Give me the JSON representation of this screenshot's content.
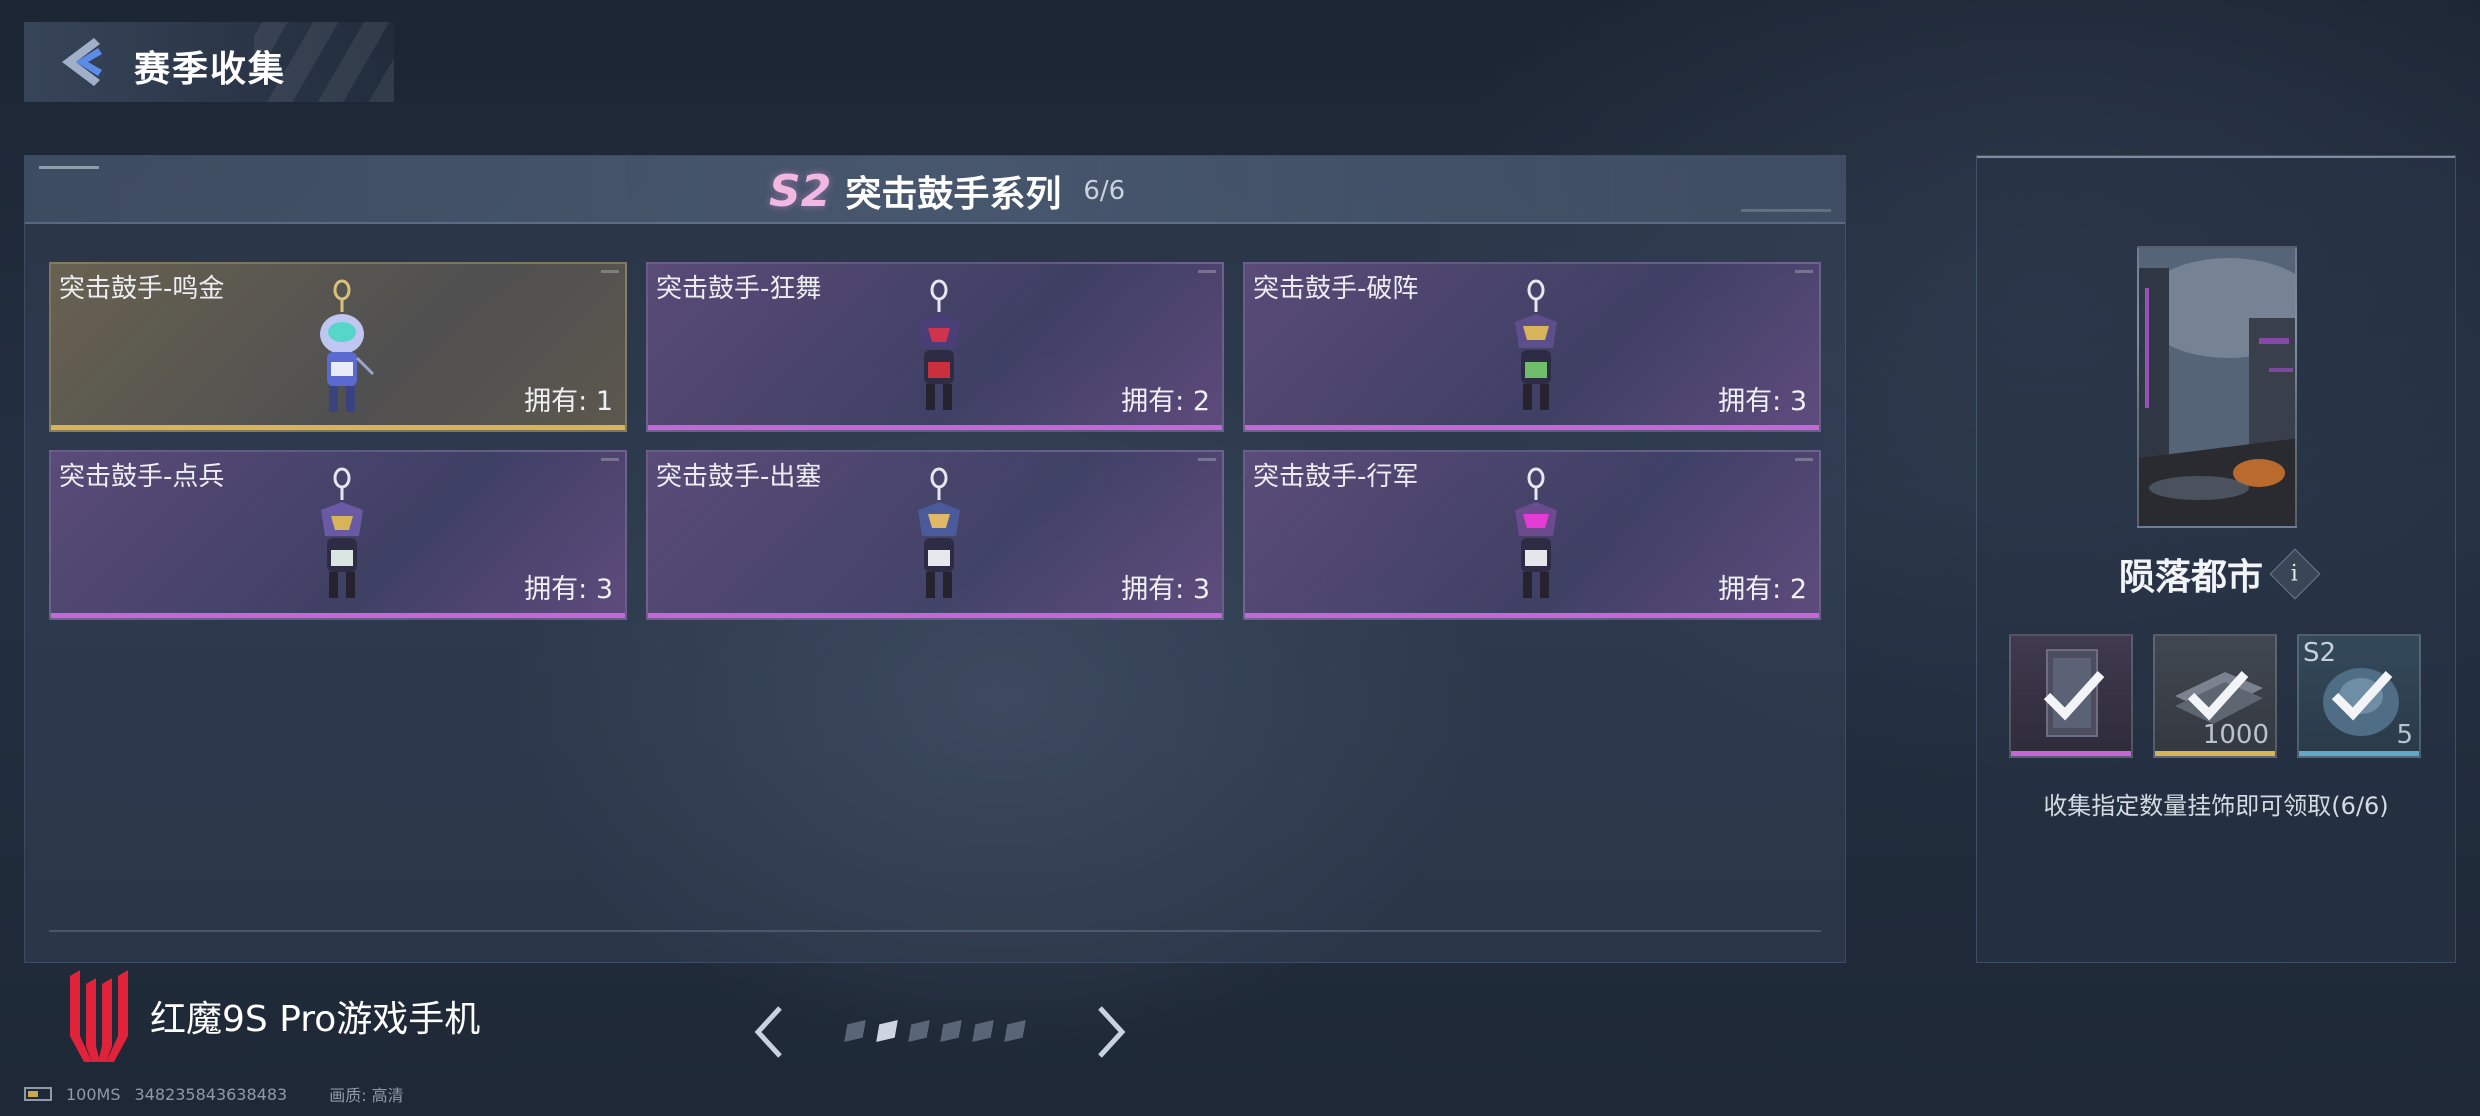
{
  "header": {
    "title": "赛季收集"
  },
  "series": {
    "badge": "S2",
    "title": "突击鼓手系列",
    "progress": "6/6"
  },
  "items": [
    {
      "name": "突击鼓手-鸣金",
      "owned": "拥有: 1",
      "rarity": "gold",
      "accent": "#d8b457"
    },
    {
      "name": "突击鼓手-狂舞",
      "owned": "拥有: 2",
      "rarity": "purple",
      "accent": "#c567d8"
    },
    {
      "name": "突击鼓手-破阵",
      "owned": "拥有: 3",
      "rarity": "purple",
      "accent": "#c567d8"
    },
    {
      "name": "突击鼓手-点兵",
      "owned": "拥有: 3",
      "rarity": "purple",
      "accent": "#c567d8"
    },
    {
      "name": "突击鼓手-出塞",
      "owned": "拥有: 3",
      "rarity": "purple",
      "accent": "#c567d8"
    },
    {
      "name": "突击鼓手-行军",
      "owned": "拥有: 2",
      "rarity": "purple",
      "accent": "#c567d8"
    }
  ],
  "reward": {
    "scene_title": "陨落都市",
    "info_icon": "i",
    "rewards": [
      {
        "kind": "card-frame",
        "qty": "",
        "tag": "",
        "claimed": true,
        "accent": "#c567d8"
      },
      {
        "kind": "token-stack",
        "qty": "1000",
        "tag": "",
        "claimed": true,
        "accent": "#d8b457"
      },
      {
        "kind": "s2-badge",
        "qty": "5",
        "tag": "S2",
        "claimed": true,
        "accent": "#5fa8c8"
      }
    ],
    "note": "收集指定数量挂饰即可领取(6/6)"
  },
  "footer": {
    "brand": "红魔9S Pro游戏手机",
    "pager": {
      "pages": 6,
      "current": 2
    }
  },
  "status": {
    "ping": "100MS",
    "uid": "348235843638483",
    "quality": "画质: 高清"
  },
  "colors": {
    "gold": "#d8b457",
    "purple": "#c567d8",
    "brand_red": "#e0223a",
    "back_arrow_blue": "#5b8de8"
  }
}
